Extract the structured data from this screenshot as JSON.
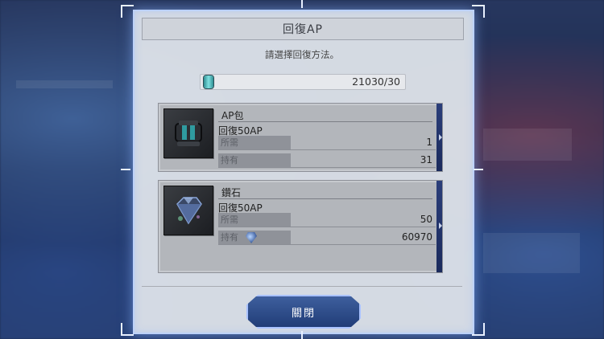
{
  "dialog": {
    "title": "回復AP",
    "instruction": "請選擇回復方法。",
    "ap_value": "21030/30",
    "close_label": "關閉"
  },
  "items": [
    {
      "name": "AP包",
      "description": "回復50AP",
      "row1_label": "所需",
      "row1_value": "1",
      "row2_label": "持有",
      "row2_value": "31",
      "icon": "ap-pack-icon"
    },
    {
      "name": "鑽石",
      "description": "回復50AP",
      "row1_label": "所需",
      "row1_value": "50",
      "row2_label": "持有",
      "row2_value": "60970",
      "icon": "diamond-icon"
    }
  ],
  "colors": {
    "accent": "#2b3e7a",
    "panel": "#dce1e8",
    "button": "#2f4f8f"
  }
}
